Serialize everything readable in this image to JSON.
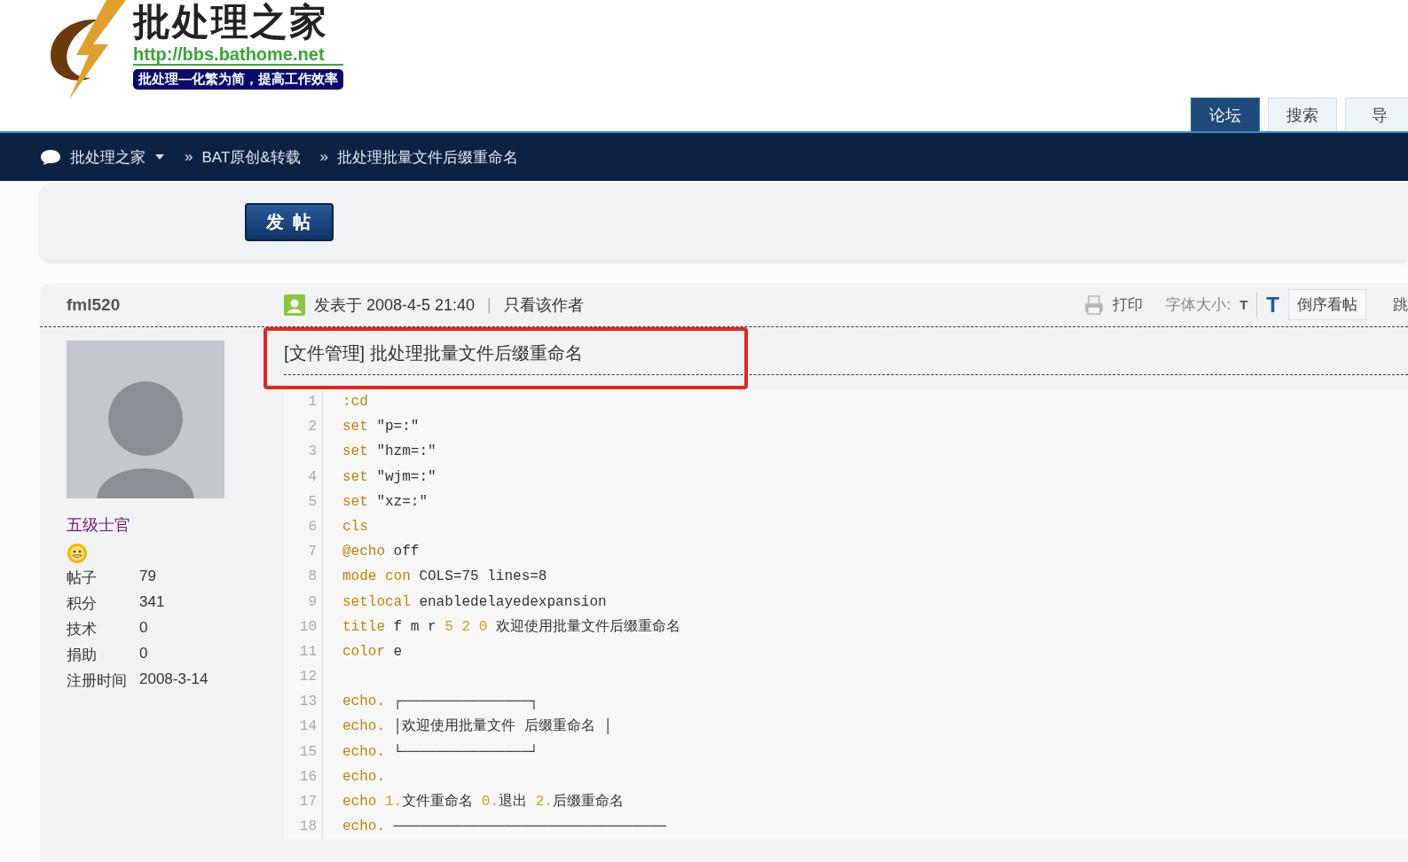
{
  "header": {
    "logo": {
      "title": "批处理之家",
      "url": "http://bbs.bathome.net",
      "slogan": "批处理—化繁为简，提高工作效率"
    },
    "tabs": [
      {
        "label": "论坛",
        "selected": true
      },
      {
        "label": "搜索",
        "selected": false
      },
      {
        "label": "导",
        "selected": false
      }
    ]
  },
  "breadcrumb": [
    {
      "label": "批处理之家",
      "dropdown": true
    },
    {
      "separator": "»",
      "label": "BAT原创&转载"
    },
    {
      "separator": "»",
      "label": "批处理批量文件后缀重命名"
    }
  ],
  "post_button": "发 帖",
  "post": {
    "author": "fml520",
    "rank": "五级士官",
    "stats": [
      {
        "label": "帖子",
        "value": "79"
      },
      {
        "label": "积分",
        "value": "341"
      },
      {
        "label": "技术",
        "value": "0"
      },
      {
        "label": "捐助",
        "value": "0"
      },
      {
        "label": "注册时间",
        "value": "2008-3-14"
      }
    ],
    "posted": "发表于 2008-4-5 21:40",
    "separator": "|",
    "author_only": "只看该作者",
    "tools": {
      "print": "打印",
      "font_size_label": "字体大小:",
      "font_small": "T",
      "font_large": "T",
      "reverse": "倒序看帖",
      "jump": "跳"
    },
    "title": "[文件管理] 批处理批量文件后缀重命名",
    "highlighted": true,
    "code": [
      {
        "number": "1",
        "tokens": [
          {
            "kind": "kw",
            "text": ":cd"
          }
        ]
      },
      {
        "number": "2",
        "tokens": [
          {
            "kind": "kw",
            "text": "set"
          },
          {
            "kind": "plain",
            "text": " \"p=:\""
          }
        ]
      },
      {
        "number": "3",
        "tokens": [
          {
            "kind": "kw",
            "text": "set"
          },
          {
            "kind": "plain",
            "text": " \"hzm=:\""
          }
        ]
      },
      {
        "number": "4",
        "tokens": [
          {
            "kind": "kw",
            "text": "set"
          },
          {
            "kind": "plain",
            "text": " \"wjm=:\""
          }
        ]
      },
      {
        "number": "5",
        "tokens": [
          {
            "kind": "kw",
            "text": "set"
          },
          {
            "kind": "plain",
            "text": " \"xz=:\""
          }
        ]
      },
      {
        "number": "6",
        "tokens": [
          {
            "kind": "kw",
            "text": "cls"
          }
        ]
      },
      {
        "number": "7",
        "tokens": [
          {
            "kind": "kw",
            "text": "@echo"
          },
          {
            "kind": "plain",
            "text": " off"
          }
        ]
      },
      {
        "number": "8",
        "tokens": [
          {
            "kind": "kw",
            "text": "mode con"
          },
          {
            "kind": "plain",
            "text": " COLS=75 lines=8"
          }
        ]
      },
      {
        "number": "9",
        "tokens": [
          {
            "kind": "kw",
            "text": "setlocal"
          },
          {
            "kind": "plain",
            "text": " enabledelayedexpansion"
          }
        ]
      },
      {
        "number": "10",
        "tokens": [
          {
            "kind": "kw",
            "text": "title"
          },
          {
            "kind": "plain",
            "text": " f m r "
          },
          {
            "kind": "num",
            "text": "5 2 0"
          },
          {
            "kind": "plain",
            "text": " 欢迎使用批量文件后缀重命名"
          }
        ]
      },
      {
        "number": "11",
        "tokens": [
          {
            "kind": "kw",
            "text": "color"
          },
          {
            "kind": "plain",
            "text": " e"
          }
        ]
      },
      {
        "number": "12"
      },
      {
        "number": "13",
        "tokens": [
          {
            "kind": "kw",
            "text": "echo."
          },
          {
            "kind": "plain",
            "text": " ┌───────────────┐"
          }
        ]
      },
      {
        "number": "14",
        "tokens": [
          {
            "kind": "kw",
            "text": "echo."
          },
          {
            "kind": "plain",
            "text": " │欢迎使用批量文件 后缀重命名 │"
          }
        ]
      },
      {
        "number": "15",
        "tokens": [
          {
            "kind": "kw",
            "text": "echo."
          },
          {
            "kind": "plain",
            "text": " └───────────────┘"
          }
        ]
      },
      {
        "number": "16",
        "tokens": [
          {
            "kind": "kw",
            "text": "echo."
          }
        ]
      },
      {
        "number": "17",
        "tokens": [
          {
            "kind": "kw",
            "text": "echo"
          },
          {
            "kind": "num",
            "text": " 1."
          },
          {
            "kind": "plain",
            "text": "文件重命名 "
          },
          {
            "kind": "num",
            "text": "0."
          },
          {
            "kind": "plain",
            "text": "退出 "
          },
          {
            "kind": "num",
            "text": "2."
          },
          {
            "kind": "plain",
            "text": "后缀重命名"
          }
        ]
      },
      {
        "number": "18",
        "tokens": [
          {
            "kind": "kw",
            "text": "echo."
          },
          {
            "kind": "plain",
            "text": " ────────────────────────────────"
          }
        ]
      }
    ]
  }
}
